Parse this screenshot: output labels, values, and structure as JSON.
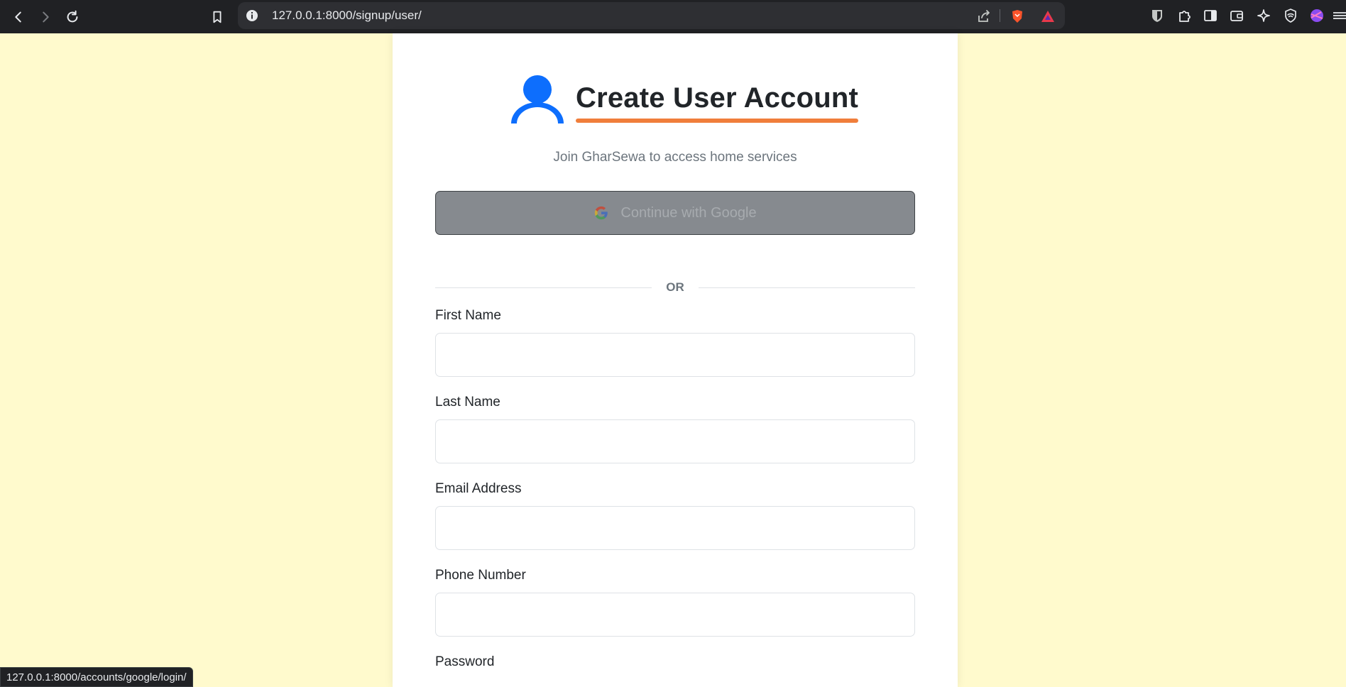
{
  "browser": {
    "url": "127.0.0.1:8000/signup/user/",
    "status_url": "127.0.0.1:8000/accounts/google/login/"
  },
  "header": {
    "title": "Create User Account",
    "subtitle": "Join GharSewa to access home services"
  },
  "google": {
    "label": "Continue with Google"
  },
  "divider": {
    "text": "OR"
  },
  "fields": {
    "first_name": {
      "label": "First Name",
      "value": "",
      "placeholder": ""
    },
    "last_name": {
      "label": "Last Name",
      "value": "",
      "placeholder": ""
    },
    "email": {
      "label": "Email Address",
      "value": "",
      "placeholder": ""
    },
    "phone": {
      "label": "Phone Number",
      "value": "",
      "placeholder": ""
    },
    "password": {
      "label": "Password"
    }
  },
  "colors": {
    "accent_blue": "#0d6efd",
    "underline_orange": "#f07e3b",
    "page_bg": "#fffacd",
    "google_btn_bg": "#868a8f"
  }
}
